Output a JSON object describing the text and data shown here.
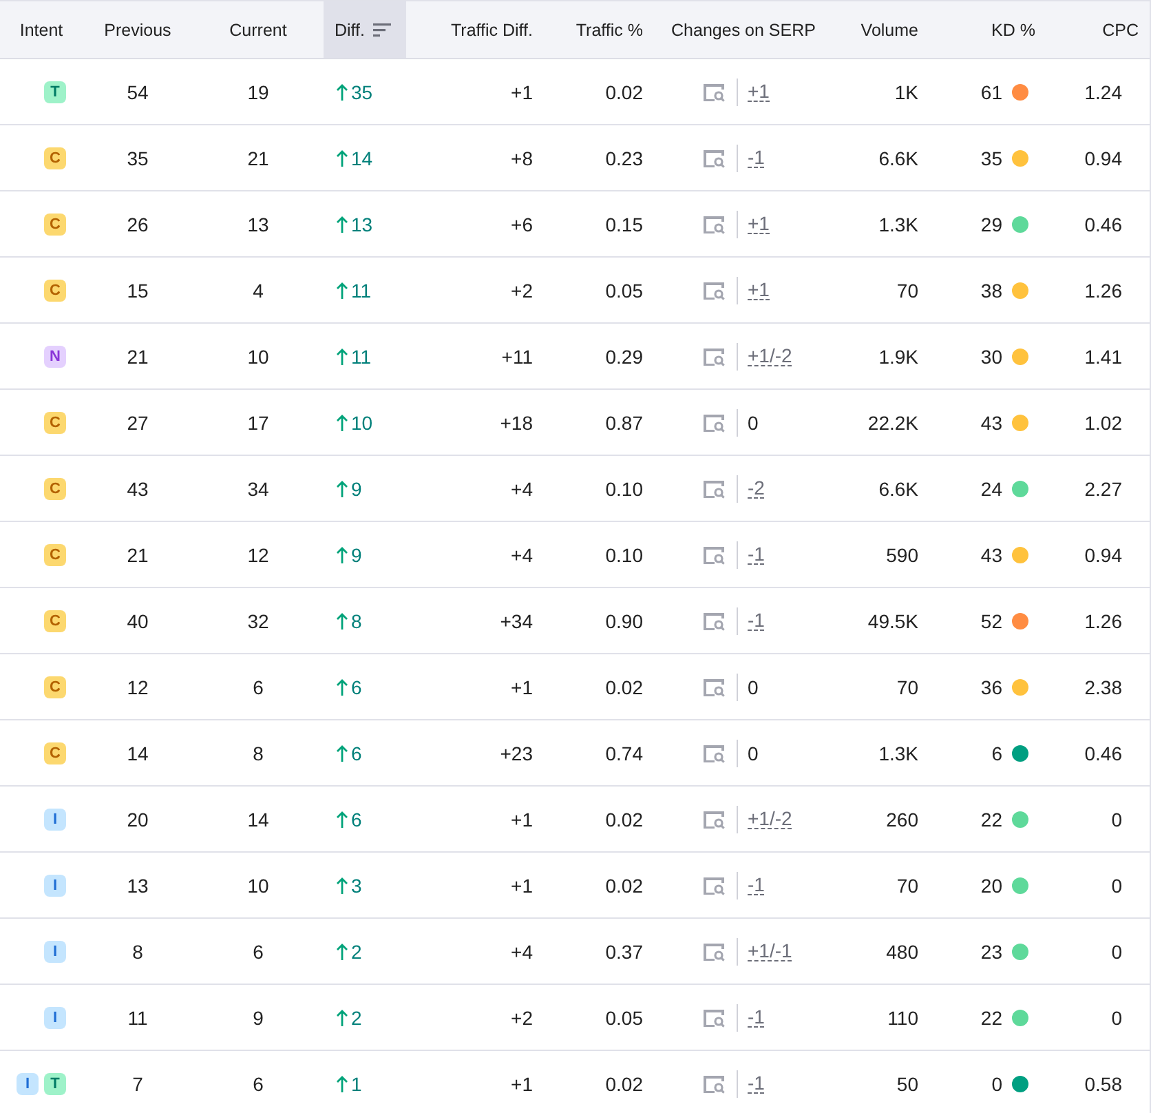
{
  "columns": [
    {
      "label": "Intent",
      "sorted": false
    },
    {
      "label": "Previous",
      "sorted": false
    },
    {
      "label": "Current",
      "sorted": false
    },
    {
      "label": "Diff.",
      "sorted": true
    },
    {
      "label": "Traffic Diff.",
      "sorted": false
    },
    {
      "label": "Traffic %",
      "sorted": false
    },
    {
      "label": "Changes on SERP",
      "sorted": false
    },
    {
      "label": "Volume",
      "sorted": false
    },
    {
      "label": "KD %",
      "sorted": false
    },
    {
      "label": "CPC",
      "sorted": false
    }
  ],
  "rows": [
    {
      "intents": [
        {
          "label": "T",
          "kind": "transactional"
        }
      ],
      "previous": "54",
      "current": "19",
      "diff": "35",
      "traffic_diff": "+1",
      "traffic_pct": "0.02",
      "serp": {
        "text": "+1",
        "linked": true
      },
      "volume": "1K",
      "kd": "61",
      "color": "#ff8c42",
      "cpc": "1.24"
    },
    {
      "intents": [
        {
          "label": "C",
          "kind": "commercial"
        }
      ],
      "previous": "35",
      "current": "21",
      "diff": "14",
      "traffic_diff": "+8",
      "traffic_pct": "0.23",
      "serp": {
        "text": "-1",
        "linked": true
      },
      "volume": "6.6K",
      "kd": "35",
      "color": "#ffc23d",
      "cpc": "0.94"
    },
    {
      "intents": [
        {
          "label": "C",
          "kind": "commercial"
        }
      ],
      "previous": "26",
      "current": "13",
      "diff": "13",
      "traffic_diff": "+6",
      "traffic_pct": "0.15",
      "serp": {
        "text": "+1",
        "linked": true
      },
      "volume": "1.3K",
      "kd": "29",
      "color": "#5ed99a",
      "cpc": "0.46"
    },
    {
      "intents": [
        {
          "label": "C",
          "kind": "commercial"
        }
      ],
      "previous": "15",
      "current": "4",
      "diff": "11",
      "traffic_diff": "+2",
      "traffic_pct": "0.05",
      "serp": {
        "text": "+1",
        "linked": true
      },
      "volume": "70",
      "kd": "38",
      "color": "#ffc23d",
      "cpc": "1.26"
    },
    {
      "intents": [
        {
          "label": "N",
          "kind": "navigational"
        }
      ],
      "previous": "21",
      "current": "10",
      "diff": "11",
      "traffic_diff": "+11",
      "traffic_pct": "0.29",
      "serp": {
        "text": "+1/-2",
        "linked": true
      },
      "volume": "1.9K",
      "kd": "30",
      "color": "#ffc23d",
      "cpc": "1.41"
    },
    {
      "intents": [
        {
          "label": "C",
          "kind": "commercial"
        }
      ],
      "previous": "27",
      "current": "17",
      "diff": "10",
      "traffic_diff": "+18",
      "traffic_pct": "0.87",
      "serp": {
        "text": "0",
        "linked": false
      },
      "volume": "22.2K",
      "kd": "43",
      "color": "#ffc23d",
      "cpc": "1.02"
    },
    {
      "intents": [
        {
          "label": "C",
          "kind": "commercial"
        }
      ],
      "previous": "43",
      "current": "34",
      "diff": "9",
      "traffic_diff": "+4",
      "traffic_pct": "0.10",
      "serp": {
        "text": "-2",
        "linked": true
      },
      "volume": "6.6K",
      "kd": "24",
      "color": "#5ed99a",
      "cpc": "2.27"
    },
    {
      "intents": [
        {
          "label": "C",
          "kind": "commercial"
        }
      ],
      "previous": "21",
      "current": "12",
      "diff": "9",
      "traffic_diff": "+4",
      "traffic_pct": "0.10",
      "serp": {
        "text": "-1",
        "linked": true
      },
      "volume": "590",
      "kd": "43",
      "color": "#ffc23d",
      "cpc": "0.94"
    },
    {
      "intents": [
        {
          "label": "C",
          "kind": "commercial"
        }
      ],
      "previous": "40",
      "current": "32",
      "diff": "8",
      "traffic_diff": "+34",
      "traffic_pct": "0.90",
      "serp": {
        "text": "-1",
        "linked": true
      },
      "volume": "49.5K",
      "kd": "52",
      "color": "#ff8c42",
      "cpc": "1.26"
    },
    {
      "intents": [
        {
          "label": "C",
          "kind": "commercial"
        }
      ],
      "previous": "12",
      "current": "6",
      "diff": "6",
      "traffic_diff": "+1",
      "traffic_pct": "0.02",
      "serp": {
        "text": "0",
        "linked": false
      },
      "volume": "70",
      "kd": "36",
      "color": "#ffc23d",
      "cpc": "2.38"
    },
    {
      "intents": [
        {
          "label": "C",
          "kind": "commercial"
        }
      ],
      "previous": "14",
      "current": "8",
      "diff": "6",
      "traffic_diff": "+23",
      "traffic_pct": "0.74",
      "serp": {
        "text": "0",
        "linked": false
      },
      "volume": "1.3K",
      "kd": "6",
      "color": "#009f81",
      "cpc": "0.46"
    },
    {
      "intents": [
        {
          "label": "I",
          "kind": "informational"
        }
      ],
      "previous": "20",
      "current": "14",
      "diff": "6",
      "traffic_diff": "+1",
      "traffic_pct": "0.02",
      "serp": {
        "text": "+1/-2",
        "linked": true
      },
      "volume": "260",
      "kd": "22",
      "color": "#5ed99a",
      "cpc": "0"
    },
    {
      "intents": [
        {
          "label": "I",
          "kind": "informational"
        }
      ],
      "previous": "13",
      "current": "10",
      "diff": "3",
      "traffic_diff": "+1",
      "traffic_pct": "0.02",
      "serp": {
        "text": "-1",
        "linked": true
      },
      "volume": "70",
      "kd": "20",
      "color": "#5ed99a",
      "cpc": "0"
    },
    {
      "intents": [
        {
          "label": "I",
          "kind": "informational"
        }
      ],
      "previous": "8",
      "current": "6",
      "diff": "2",
      "traffic_diff": "+4",
      "traffic_pct": "0.37",
      "serp": {
        "text": "+1/-1",
        "linked": true
      },
      "volume": "480",
      "kd": "23",
      "color": "#5ed99a",
      "cpc": "0"
    },
    {
      "intents": [
        {
          "label": "I",
          "kind": "informational"
        }
      ],
      "previous": "11",
      "current": "9",
      "diff": "2",
      "traffic_diff": "+2",
      "traffic_pct": "0.05",
      "serp": {
        "text": "-1",
        "linked": true
      },
      "volume": "110",
      "kd": "22",
      "color": "#5ed99a",
      "cpc": "0"
    },
    {
      "intents": [
        {
          "label": "I",
          "kind": "informational"
        },
        {
          "label": "T",
          "kind": "transactional"
        }
      ],
      "previous": "7",
      "current": "6",
      "diff": "1",
      "traffic_diff": "+1",
      "traffic_pct": "0.02",
      "serp": {
        "text": "-1",
        "linked": true
      },
      "volume": "50",
      "kd": "0",
      "color": "#009f81",
      "cpc": "0.58"
    }
  ]
}
